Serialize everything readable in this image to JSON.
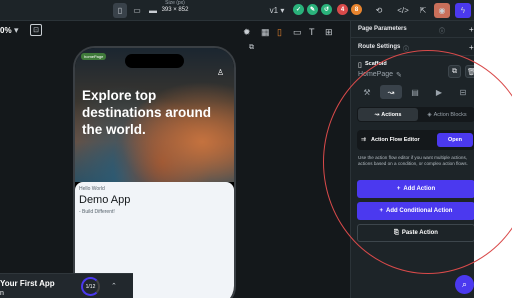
{
  "colors": {
    "accent": "#4b39ef",
    "background": "#14181b",
    "panel": "#1d2428",
    "annotation": "#d94a4a"
  },
  "topbar": {
    "size_label": "Size (px)",
    "size_value": "393 × 852",
    "version": "v1",
    "badge_red": "4",
    "badge_orange": "8",
    "devices": [
      "phone-icon",
      "tablet-icon",
      "desktop-icon"
    ],
    "actions": [
      "check-icon",
      "comment-icon",
      "history-icon",
      "code-icon",
      "export-icon",
      "eye-icon",
      "lightning-icon"
    ]
  },
  "canvas_toolbar": {
    "zoom": "0%",
    "icons": [
      "sun-icon",
      "grid-icon",
      "phone-frame-icon",
      "tablet-frame-icon",
      "text-icon",
      "tree-icon"
    ]
  },
  "phone": {
    "pill": "homePage",
    "hero_title": "Explore top destinations around the world.",
    "hello": "Hello World",
    "demo": "Demo App",
    "sub": "- Build Different!"
  },
  "bottom_bar": {
    "title": "Your First App",
    "subtitle": "n",
    "progress": "1/12"
  },
  "panel": {
    "page_parameters": "Page Parameters",
    "route_settings": "Route Settings",
    "scaffold": "Scaffold",
    "page_name": "HomePage",
    "tabs": [
      "magic-icon",
      "action-icon",
      "properties-icon",
      "play-icon",
      "backend-icon"
    ],
    "segments": {
      "actions": "Actions",
      "action_blocks": "Action Blocks"
    },
    "action_flow_editor": "Action Flow Editor",
    "open": "Open",
    "help_text": "Use the action flow editor if you want multiple actions, actions based on a condition, or complex action flows.",
    "add_action": "Add Action",
    "add_conditional_action": "Add Conditional Action",
    "paste_action": "Paste Action"
  }
}
